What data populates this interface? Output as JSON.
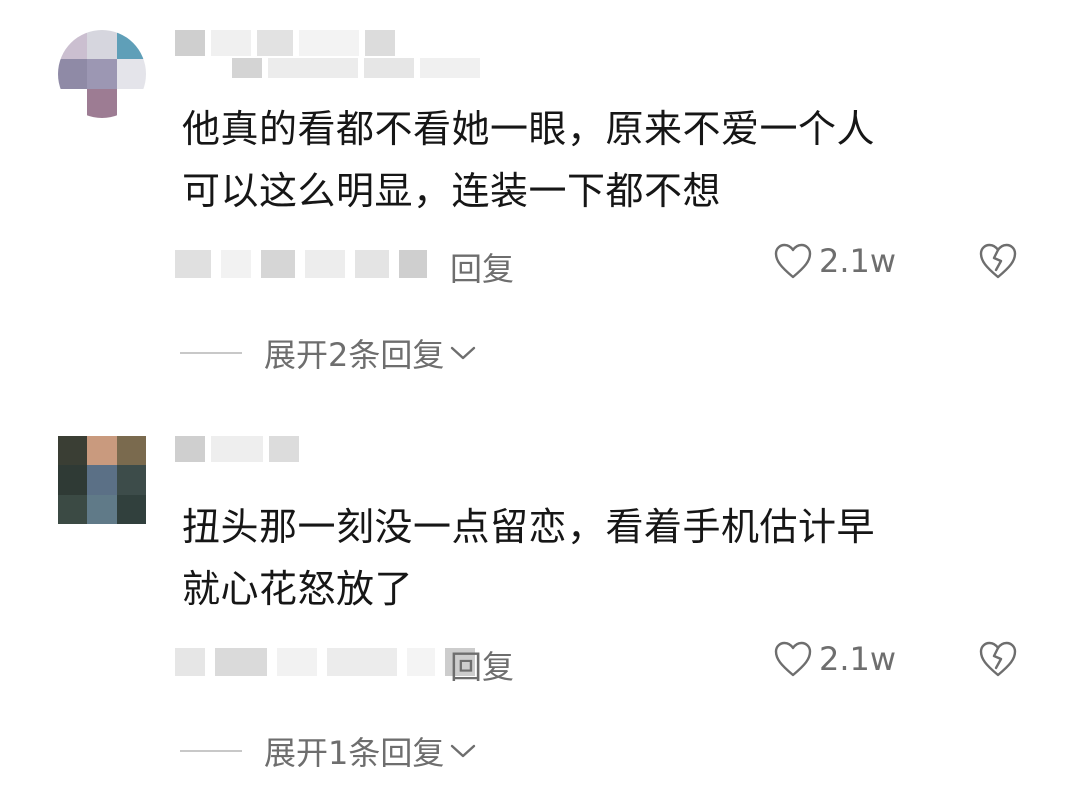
{
  "comments": [
    {
      "text_line1": "他真的看都不看她一眼，原来不爱一个人",
      "text_line2": "可以这么明显，连装一下都不想",
      "reply_label": "回复",
      "like_count": "2.1w",
      "expand_label": "展开2条回复"
    },
    {
      "text_line1": "扭头那一刻没一点留恋，看着手机估计早",
      "text_line2": "就心花怒放了",
      "reply_label": "回复",
      "like_count": "2.1w",
      "expand_label": "展开1条回复"
    }
  ],
  "icons": {
    "like": "heart-outline-icon",
    "dislike": "broken-heart-icon",
    "expand": "chevron-down-icon"
  },
  "colors": {
    "text": "#161616",
    "muted": "#6e6e6e",
    "divider": "#c8c8c8"
  }
}
